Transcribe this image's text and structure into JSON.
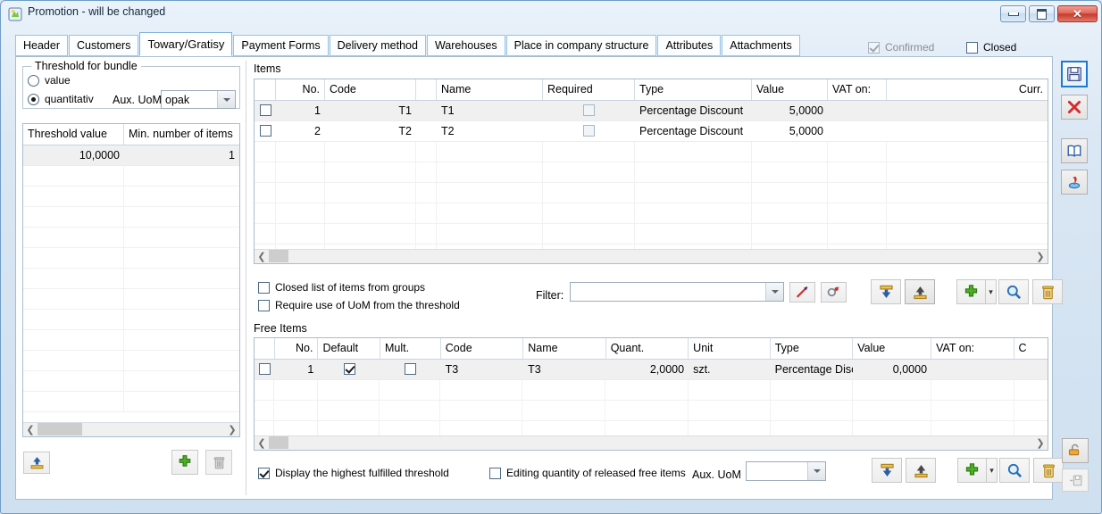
{
  "window": {
    "title": "Promotion - will be changed",
    "icon": "app-icon",
    "buttons": {
      "minimize": "–",
      "maximize": "□",
      "close": "✕"
    }
  },
  "tabs": [
    {
      "label": "Header",
      "active": false
    },
    {
      "label": "Customers",
      "active": false
    },
    {
      "label": "Towary/Gratisy",
      "active": true
    },
    {
      "label": "Payment Forms",
      "active": false
    },
    {
      "label": "Delivery method",
      "active": false
    },
    {
      "label": "Warehouses",
      "active": false
    },
    {
      "label": "Place in company structure",
      "active": false
    },
    {
      "label": "Attributes",
      "active": false
    },
    {
      "label": "Attachments",
      "active": false
    }
  ],
  "header_flags": [
    {
      "label": "Confirmed",
      "checked": true,
      "disabled": true
    },
    {
      "label": "Closed",
      "checked": false,
      "disabled": false
    }
  ],
  "threshold_panel": {
    "legend": "Threshold for bundle",
    "options": [
      {
        "label": "value",
        "selected": false
      },
      {
        "label": "quantitativ",
        "selected": true
      }
    ],
    "aux_uom_label": "Aux. UoM",
    "aux_uom_value": "opak",
    "grid": {
      "columns": [
        "Threshold value",
        "Min. number of items"
      ],
      "rows": [
        [
          "10,0000",
          "1"
        ]
      ]
    },
    "toolbar": [
      {
        "name": "export-icon",
        "enabled": true
      },
      {
        "name": "add-icon",
        "enabled": true
      },
      {
        "name": "delete-icon",
        "enabled": false
      }
    ]
  },
  "items_section": {
    "title": "Items",
    "columns": [
      "",
      "No.",
      "Code",
      "",
      "Name",
      "Required",
      "Type",
      "Value",
      "VAT on:",
      "Curr."
    ],
    "rows": [
      {
        "sel": false,
        "no": "1",
        "code_pre": "",
        "code": "T1",
        "name": "T1",
        "required": false,
        "type": "Percentage Discount",
        "value": "5,0000",
        "vat_on": "",
        "curr": ""
      },
      {
        "sel": false,
        "no": "2",
        "code_pre": "",
        "code": "T2",
        "name": "T2",
        "required": false,
        "type": "Percentage Discount",
        "value": "5,0000",
        "vat_on": "",
        "curr": ""
      }
    ],
    "options": [
      {
        "label": "Closed list of items from groups",
        "checked": false
      },
      {
        "label": "Require use of UoM from the threshold",
        "checked": false
      }
    ],
    "filter_label": "Filter:",
    "filter_value": "",
    "filter_buttons": [
      {
        "name": "clear-filter-icon"
      },
      {
        "name": "filter-builder-icon"
      }
    ],
    "toolbar": [
      {
        "name": "import-icon"
      },
      {
        "name": "export-icon"
      },
      {
        "name": "add-icon"
      },
      {
        "name": "add-dropdown-icon"
      },
      {
        "name": "search-icon"
      },
      {
        "name": "delete-icon"
      }
    ]
  },
  "free_items_section": {
    "title": "Free Items",
    "columns": [
      "",
      "No.",
      "Default",
      "Mult.",
      "Code",
      "Name",
      "Quant.",
      "Unit",
      "Type",
      "Value",
      "VAT on:",
      "C"
    ],
    "rows": [
      {
        "sel": false,
        "no": "1",
        "default": true,
        "mult": false,
        "code": "T3",
        "name": "T3",
        "quant": "2,0000",
        "unit": "szt.",
        "type": "Percentage Disco",
        "value": "0,0000",
        "vat_on": "",
        "curr": ""
      }
    ],
    "options": [
      {
        "label": "Display the highest fulfilled threshold",
        "checked": true
      },
      {
        "label": "Editing quantity of released free items",
        "checked": false
      }
    ],
    "aux_uom_label": "Aux. UoM",
    "aux_uom_value": "",
    "toolbar": [
      {
        "name": "import-icon"
      },
      {
        "name": "export-icon"
      },
      {
        "name": "add-icon"
      },
      {
        "name": "add-dropdown-icon"
      },
      {
        "name": "search-icon"
      },
      {
        "name": "delete-icon"
      }
    ]
  },
  "side_toolbar": [
    {
      "name": "save-button",
      "selected": true
    },
    {
      "name": "close-button",
      "selected": false
    },
    {
      "name": "help-book-button",
      "selected": false
    },
    {
      "name": "paste-button",
      "selected": false
    }
  ],
  "corner_toolbar": [
    {
      "name": "unlock-button",
      "enabled": true
    },
    {
      "name": "save-layout-button",
      "enabled": false
    }
  ],
  "colors": {
    "accent": "#1f78d1",
    "window_border": "#6f9dc9",
    "row_alt": "#f0f0f0",
    "green": "#3fae2a",
    "red": "#cc2b2b"
  }
}
